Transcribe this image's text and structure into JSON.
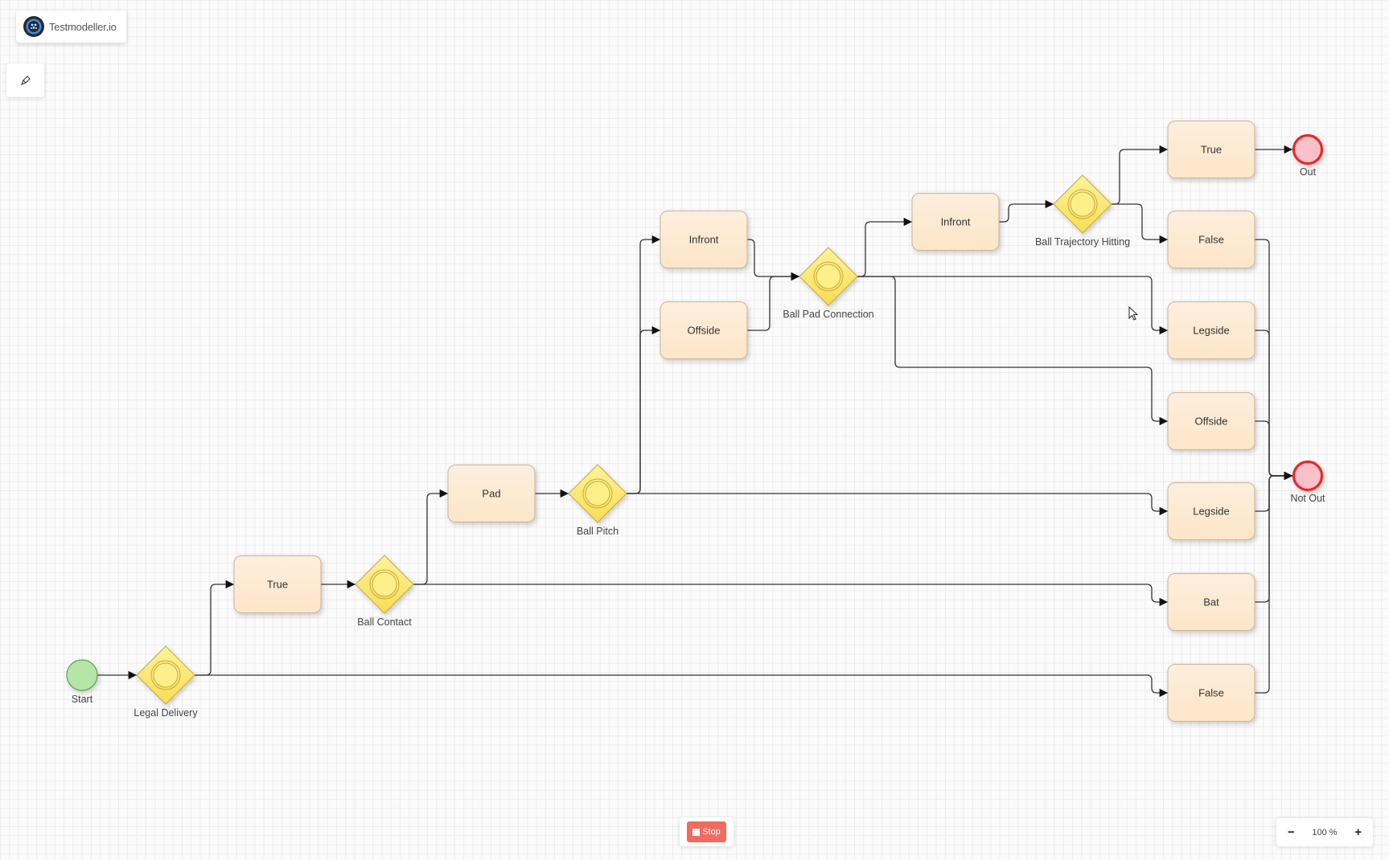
{
  "app": {
    "brand_name": "Testmodeller.io"
  },
  "toolbar": {
    "edit_tool_icon": "brush-icon"
  },
  "controls": {
    "stop_label": "Stop",
    "zoom_out": "−",
    "zoom_level": "100 %",
    "zoom_in": "+"
  },
  "colors": {
    "task_fill": "#fdebd3",
    "task_stroke": "#c9b49c",
    "gateway_fill": "#fbe77a",
    "gateway_stroke": "#c8a93a",
    "start_fill": "#b5e6a6",
    "start_stroke": "#5e9e58",
    "end_fill": "#f8c0c8",
    "end_stroke": "#e52b2b",
    "stop_button": "#f06b5f",
    "edge": "#333333"
  },
  "diagram": {
    "nodes": [
      {
        "id": "start",
        "type": "start",
        "label": "Start"
      },
      {
        "id": "legal_delivery",
        "type": "gateway",
        "label": "Legal Delivery"
      },
      {
        "id": "true1",
        "type": "task",
        "label": "True"
      },
      {
        "id": "ball_contact",
        "type": "gateway",
        "label": "Ball Contact"
      },
      {
        "id": "pad",
        "type": "task",
        "label": "Pad"
      },
      {
        "id": "ball_pitch",
        "type": "gateway",
        "label": "Ball Pitch"
      },
      {
        "id": "infront1",
        "type": "task",
        "label": "Infront"
      },
      {
        "id": "offside1",
        "type": "task",
        "label": "Offside"
      },
      {
        "id": "ball_pad_connection",
        "type": "gateway",
        "label": "Ball Pad Connection"
      },
      {
        "id": "infront2",
        "type": "task",
        "label": "Infront"
      },
      {
        "id": "ball_trajectory_hitting",
        "type": "gateway",
        "label": "Ball Trajectory Hitting"
      },
      {
        "id": "true2",
        "type": "task",
        "label": "True"
      },
      {
        "id": "false1",
        "type": "task",
        "label": "False"
      },
      {
        "id": "legside1",
        "type": "task",
        "label": "Legside"
      },
      {
        "id": "offside2",
        "type": "task",
        "label": "Offside"
      },
      {
        "id": "legside2",
        "type": "task",
        "label": "Legside"
      },
      {
        "id": "bat",
        "type": "task",
        "label": "Bat"
      },
      {
        "id": "false2",
        "type": "task",
        "label": "False"
      },
      {
        "id": "out",
        "type": "end",
        "label": "Out"
      },
      {
        "id": "not_out",
        "type": "end",
        "label": "Not Out"
      }
    ],
    "edges": [
      [
        "start",
        "legal_delivery"
      ],
      [
        "legal_delivery",
        "true1"
      ],
      [
        "legal_delivery",
        "false2"
      ],
      [
        "true1",
        "ball_contact"
      ],
      [
        "ball_contact",
        "pad"
      ],
      [
        "ball_contact",
        "bat"
      ],
      [
        "pad",
        "ball_pitch"
      ],
      [
        "ball_pitch",
        "infront1"
      ],
      [
        "ball_pitch",
        "offside1"
      ],
      [
        "ball_pitch",
        "legside2"
      ],
      [
        "infront1",
        "ball_pad_connection"
      ],
      [
        "offside1",
        "ball_pad_connection"
      ],
      [
        "ball_pad_connection",
        "infront2"
      ],
      [
        "ball_pad_connection",
        "legside1"
      ],
      [
        "ball_pad_connection",
        "offside2"
      ],
      [
        "infront2",
        "ball_trajectory_hitting"
      ],
      [
        "ball_trajectory_hitting",
        "true2"
      ],
      [
        "ball_trajectory_hitting",
        "false1"
      ],
      [
        "true2",
        "out"
      ],
      [
        "false1",
        "not_out"
      ],
      [
        "legside1",
        "not_out"
      ],
      [
        "offside2",
        "not_out"
      ],
      [
        "legside2",
        "not_out"
      ],
      [
        "bat",
        "not_out"
      ],
      [
        "false2",
        "not_out"
      ]
    ]
  }
}
